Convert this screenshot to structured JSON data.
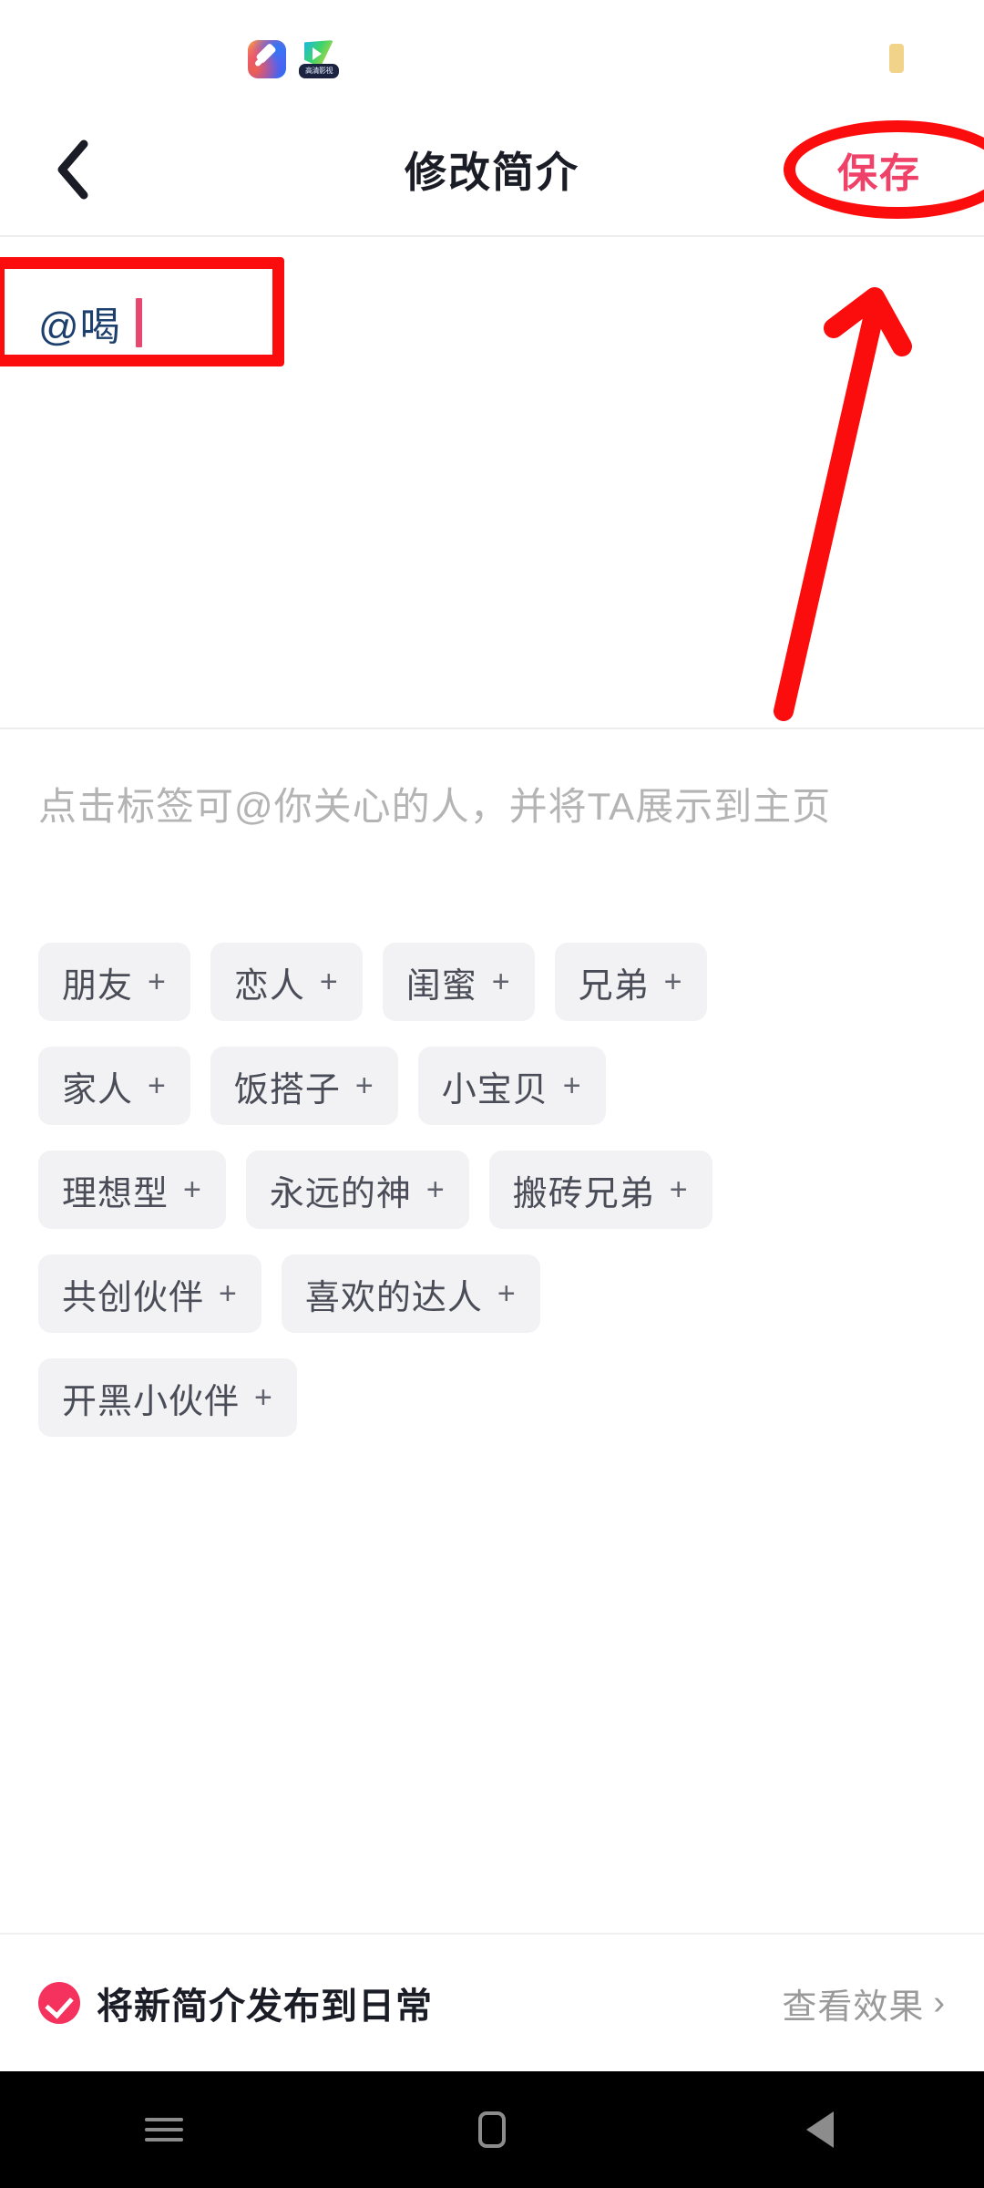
{
  "statusbar": {
    "notification_icons": [
      "app-icon-colorful",
      "video-play-icon"
    ],
    "video_badge_text": "高清影视",
    "battery_icon": "battery-icon"
  },
  "titlebar": {
    "back_icon": "chevron-left-icon",
    "title": "修改简介",
    "save_label": "保存",
    "save_color": "#f04168"
  },
  "editor": {
    "value": "@喝",
    "caret_color": "#e8476f",
    "text_color": "#1d3f6e"
  },
  "hint": "点击标签可@你关心的人，并将TA展示到主页",
  "tag_rows": [
    [
      {
        "label": "朋友",
        "plus": "+"
      },
      {
        "label": "恋人",
        "plus": "+"
      },
      {
        "label": "闺蜜",
        "plus": "+"
      },
      {
        "label": "兄弟",
        "plus": "+"
      }
    ],
    [
      {
        "label": "家人",
        "plus": "+"
      },
      {
        "label": "饭搭子",
        "plus": "+"
      },
      {
        "label": "小宝贝",
        "plus": "+"
      }
    ],
    [
      {
        "label": "理想型",
        "plus": "+"
      },
      {
        "label": "永远的神",
        "plus": "+"
      },
      {
        "label": "搬砖兄弟",
        "plus": "+"
      }
    ],
    [
      {
        "label": "共创伙伴",
        "plus": "+"
      },
      {
        "label": "喜欢的达人",
        "plus": "+"
      }
    ],
    [
      {
        "label": "开黑小伙伴",
        "plus": "+"
      }
    ]
  ],
  "bottombar": {
    "checkbox_checked": true,
    "checkbox_color": "#f5315e",
    "publish_label": "将新简介发布到日常",
    "preview_label": "查看效果",
    "preview_chevron": "›"
  },
  "navbar": {
    "recents_icon": "recents-icon",
    "home_icon": "home-icon",
    "back_icon": "back-triangle-icon"
  },
  "annotations": {
    "color": "#fc0d0d",
    "input_highlight": "rectangle-around-input",
    "save_highlight": "ellipse-around-save",
    "arrow": "arrow-pointing-to-save"
  }
}
